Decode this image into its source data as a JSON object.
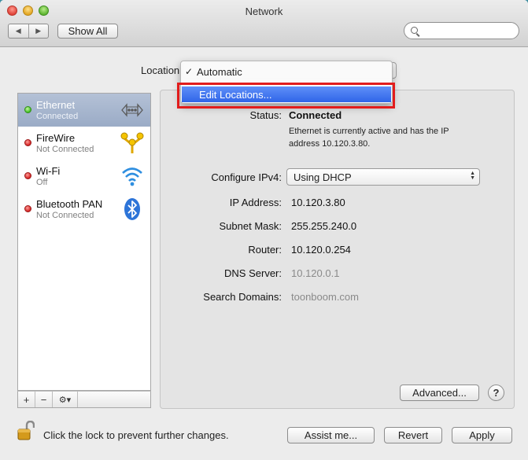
{
  "window": {
    "title": "Network"
  },
  "toolbar": {
    "back": "◀",
    "forward": "▶",
    "show_all": "Show All",
    "search_placeholder": ""
  },
  "location": {
    "label": "Location:",
    "menu": {
      "checked_item": "Automatic",
      "check_mark": "✓",
      "edit_item": "Edit Locations..."
    }
  },
  "services": [
    {
      "name": "Ethernet",
      "status": "Connected",
      "state": "green",
      "selected": true,
      "icon": "ethernet-icon"
    },
    {
      "name": "FireWire",
      "status": "Not Connected",
      "state": "red",
      "selected": false,
      "icon": "firewire-icon"
    },
    {
      "name": "Wi-Fi",
      "status": "Off",
      "state": "red",
      "selected": false,
      "icon": "wifi-icon"
    },
    {
      "name": "Bluetooth PAN",
      "status": "Not Connected",
      "state": "red",
      "selected": false,
      "icon": "bluetooth-icon"
    }
  ],
  "sidebar_controls": {
    "add": "+",
    "remove": "−",
    "gear": "⚙▾"
  },
  "detail": {
    "status_label": "Status:",
    "status_value": "Connected",
    "status_desc": "Ethernet is currently active and has the IP address 10.120.3.80.",
    "configure_label": "Configure IPv4:",
    "configure_value": "Using DHCP",
    "ip_label": "IP Address:",
    "ip_value": "10.120.3.80",
    "subnet_label": "Subnet Mask:",
    "subnet_value": "255.255.240.0",
    "router_label": "Router:",
    "router_value": "10.120.0.254",
    "dns_label": "DNS Server:",
    "dns_value": "10.120.0.1",
    "search_label": "Search Domains:",
    "search_value": "toonboom.com",
    "advanced": "Advanced...",
    "help": "?"
  },
  "footer": {
    "lock_text": "Click the lock to prevent further changes.",
    "assist": "Assist me...",
    "revert": "Revert",
    "apply": "Apply"
  },
  "colors": {
    "selection": "#9aabc6",
    "menu_highlight": "#2f65e8",
    "annotation": "#e21c1c"
  }
}
